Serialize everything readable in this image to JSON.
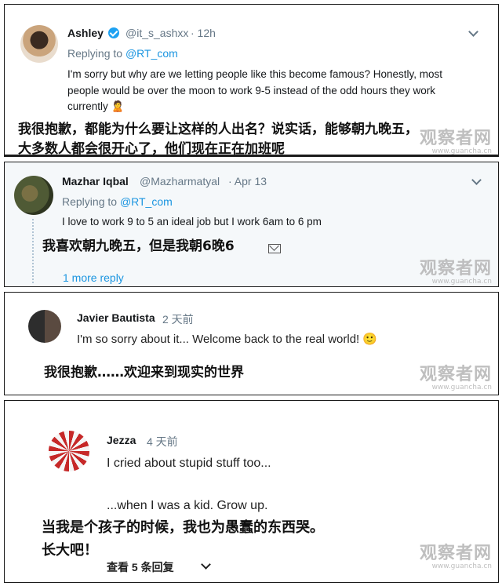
{
  "comment1": {
    "name": "Ashley",
    "handle": "@it_s_ashxx",
    "time": "· 12h",
    "replying_prefix": "Replying to ",
    "replying_handle": "@RT_com",
    "text_line1": "I'm sorry but why are we letting people like this become famous? Honestly, most",
    "text_line2": "people would be over the moon to work 9-5 instead of the odd hours they work",
    "text_line3": "currently",
    "emoji": "🙎",
    "zh_line1": "我很抱歉，都能为什么要让这样的人出名？说实话，能够朝九晚五，",
    "zh_line2": "大多数人都会很开心了，他们现在正在加班呢",
    "watermark": "观察者网",
    "watermark_url": "www.guancha.cn"
  },
  "comment2": {
    "name": "Mazhar Iqbal",
    "handle": "@Mazharmatyal",
    "time": "· Apr 13",
    "replying_prefix": "Replying to ",
    "replying_handle": "@RT_com",
    "text": "I love to work 9 to 5 an ideal job but I work 6am to 6 pm",
    "zh": "我喜欢朝九晚五，但是我朝6晚6",
    "more_reply": "1 more reply",
    "watermark": "观察者网",
    "watermark_url": "www.guancha.cn"
  },
  "comment3": {
    "name": "Javier Bautista",
    "time": "2 天前",
    "text": "I'm so sorry about it... Welcome back to the real world! 🙂",
    "zh": "我很抱歉……欢迎来到现实的世界",
    "watermark": "观察者网",
    "watermark_url": "www.guancha.cn"
  },
  "comment4": {
    "name": "Jezza",
    "time": "4 天前",
    "text_line1": "I cried about stupid stuff too...",
    "text_line2": "...when I was a kid. Grow up.",
    "zh_line1": "当我是个孩子的时候，我也为愚蠢的东西哭。",
    "zh_line2": "长大吧！",
    "view_replies": "查看 5 条回复",
    "watermark": "观察者网",
    "watermark_url": "www.guancha.cn"
  }
}
